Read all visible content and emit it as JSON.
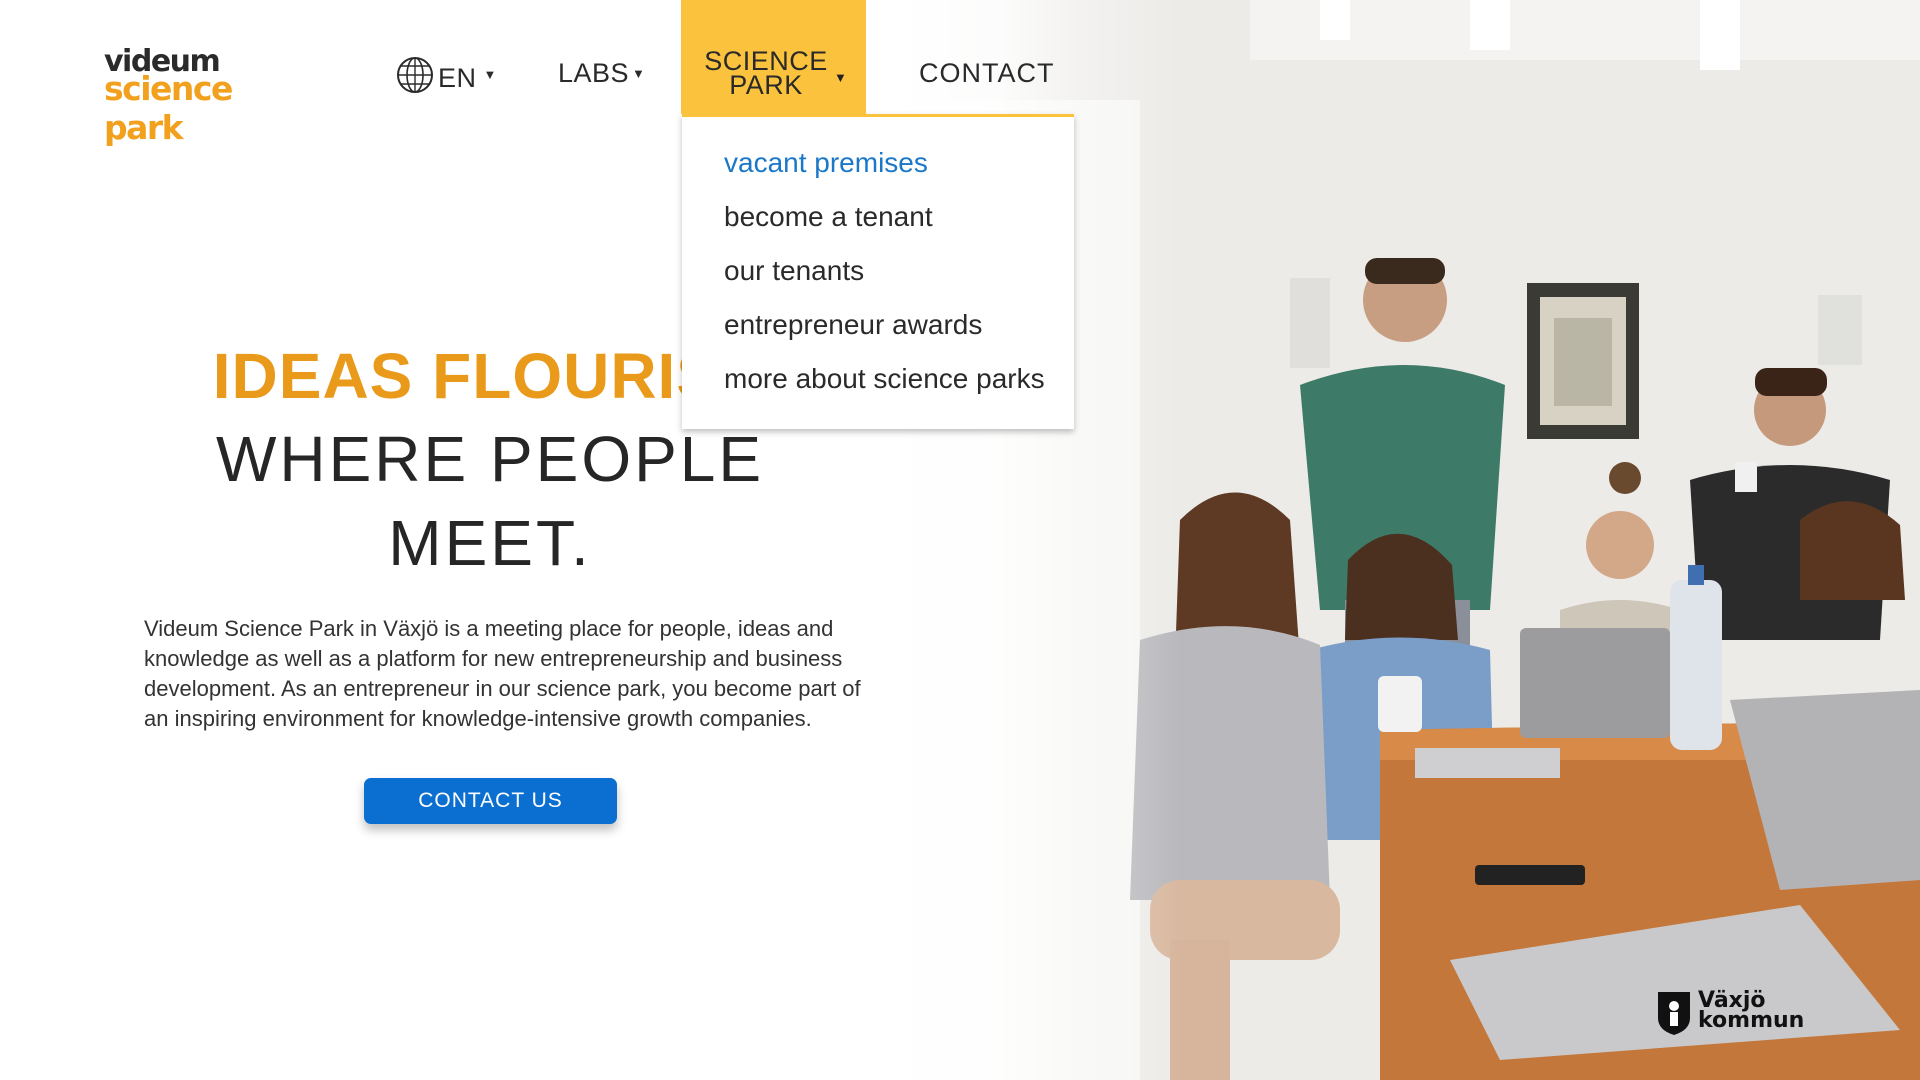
{
  "brand": {
    "logo_line1": "videum",
    "logo_line2": "science park",
    "accent": "#f2a11f",
    "nav_highlight": "#fbc23d",
    "link_active": "#1b78c9",
    "cta_color": "#0b6fd1"
  },
  "nav": {
    "language": "EN",
    "labs": "LABS",
    "science_park_line1": "SCIENCE",
    "science_park_line2": "PARK",
    "contact": "CONTACT",
    "globe_icon": "globe-icon",
    "caret_icon": "caret-down-icon"
  },
  "dropdown": {
    "items": [
      {
        "label": "vacant premises",
        "active": true
      },
      {
        "label": "become a tenant",
        "active": false
      },
      {
        "label": "our tenants",
        "active": false
      },
      {
        "label": "entrepreneur awards",
        "active": false
      },
      {
        "label": "more about science parks",
        "active": false
      }
    ]
  },
  "hero": {
    "headline_accent": "IDEAS FLOURISH",
    "headline_line2": "WHERE PEOPLE",
    "headline_line3": "MEET.",
    "body": "Videum Science Park in Växjö is a meeting place for people, ideas and knowledge as well as a platform for new entrepreneurship and business development. As an entrepreneur in our science park, you become part of an inspiring environment for knowledge-intensive growth companies.",
    "cta": "CONTACT US"
  },
  "footer": {
    "partner_line1": "Växjö",
    "partner_line2": "kommun",
    "partner_icon": "vaxjo-crest-icon"
  }
}
